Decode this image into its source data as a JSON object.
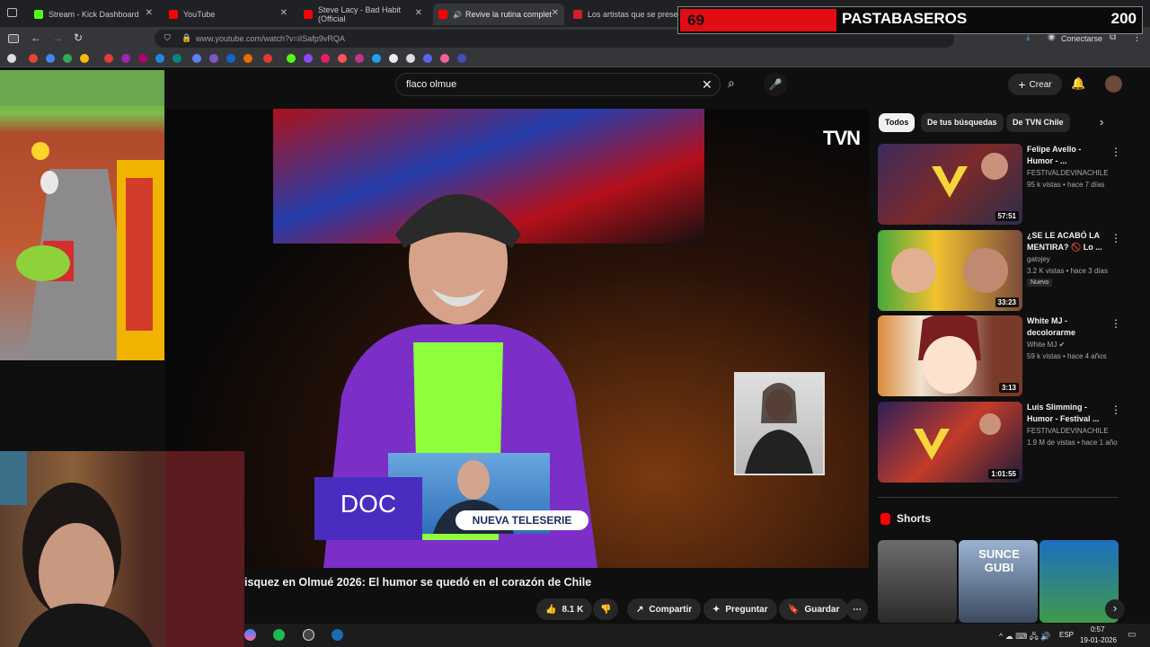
{
  "browser": {
    "tabs": [
      {
        "label": "Stream - Kick Dashboard",
        "icon": "kick-icon",
        "color": "#53fc18"
      },
      {
        "label": "YouTube",
        "icon": "youtube-icon",
        "color": "#ff0000"
      },
      {
        "label": "Steve Lacy - Bad Habit (Official",
        "icon": "youtube-icon",
        "color": "#ff0000"
      },
      {
        "label": "Revive la rutina completa d",
        "icon": "youtube-icon",
        "color": "#ff0000"
      },
      {
        "label": "Los artistas que se presentan",
        "icon": "lt-icon",
        "color": "#d21c2c"
      }
    ],
    "url": "www.youtube.com/watch?v=iISafp9vRQA",
    "connect_label": "Conectarse"
  },
  "overlay": {
    "left_number": "69",
    "name": "PASTABASEROS",
    "right_number": "200"
  },
  "youtube": {
    "search_value": "flaco olmue",
    "create_label": "Crear",
    "chips": [
      "Todos",
      "De tus búsquedas",
      "De TVN Chile"
    ],
    "video": {
      "channel_logo": "TVN",
      "doc_text": "DOC",
      "ad_text": "NUEVA TELESERIE",
      "title": "isquez en Olmué 2026: El humor se quedó en el corazón de Chile",
      "likes": "8.1 K",
      "share_label": "Compartir",
      "ask_label": "Preguntar",
      "save_label": "Guardar"
    },
    "recommendations": [
      {
        "title": "Felipe Avello - Humor - ...",
        "channel": "FESTIVALDEVINACHILE",
        "meta": "95 k vistas • hace 7 días",
        "duration": "57:51",
        "badge": ""
      },
      {
        "title": "¿SE LE ACABÓ LA MENTIRA? 🚫 Lo ...",
        "channel": "gatojey",
        "meta": "3.2 K vistas • hace 3 días",
        "duration": "33:23",
        "badge": "Nuevo"
      },
      {
        "title": "White MJ - decolorarme",
        "channel": "White MJ",
        "meta": "59 k vistas • hace 4 años",
        "duration": "3:13",
        "badge": ""
      },
      {
        "title": "Luis Slimming - Humor - Festival ...",
        "channel": "FESTIVALDEVINACHILE",
        "meta": "1.9 M de vistas • hace 1 año",
        "duration": "1:01:55",
        "badge": ""
      }
    ],
    "shorts_label": "Shorts",
    "shorts": [
      "",
      "SUNCE GUBI",
      ""
    ]
  },
  "taskbar": {
    "lang": "ESP",
    "time": "0:57",
    "date": "19-01-2026"
  },
  "colors": {
    "youtube_red": "#ff0000",
    "overlay_red": "#e10c14",
    "page_bg": "#0f0f0f"
  }
}
